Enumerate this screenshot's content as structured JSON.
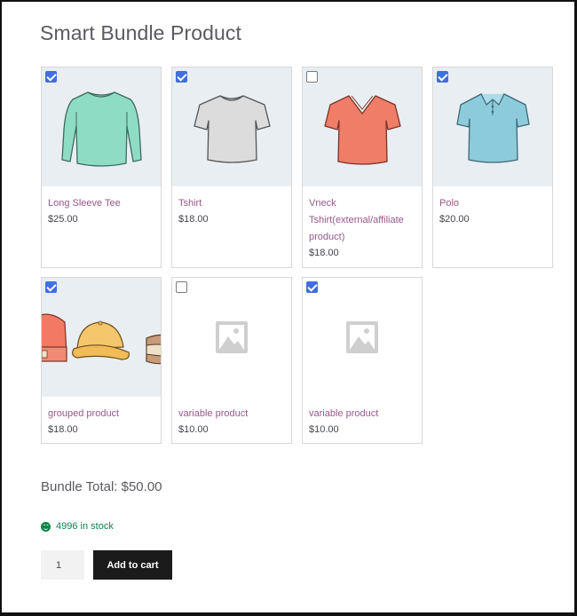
{
  "page": {
    "title": "Smart Bundle Product"
  },
  "products": [
    {
      "name": "Long Sleeve Tee",
      "price": "$25.00",
      "checked": true,
      "image": "long-sleeve-tee-image",
      "color": "#7fd6c0"
    },
    {
      "name": "Tshirt",
      "price": "$18.00",
      "checked": true,
      "image": "tshirt-image",
      "color": "#d9d9d9"
    },
    {
      "name": "Vneck Tshirt(external/affiliate product)",
      "price": "$18.00",
      "checked": false,
      "image": "vneck-tshirt-image",
      "color": "#ef7a66"
    },
    {
      "name": "Polo",
      "price": "$20.00",
      "checked": true,
      "image": "polo-image",
      "color": "#86c7da"
    },
    {
      "name": "grouped product",
      "price": "$18.00",
      "checked": true,
      "image": "hats-image",
      "color": "#f2c36b"
    },
    {
      "name": "variable product",
      "price": "$10.00",
      "checked": false,
      "image": "placeholder-image",
      "color": "#cfcfcf"
    },
    {
      "name": "variable product",
      "price": "$10.00",
      "checked": true,
      "image": "placeholder-image",
      "color": "#cfcfcf"
    }
  ],
  "bundle": {
    "total_label": "Bundle Total: $50.00"
  },
  "stock": {
    "text": "4996 in stock",
    "color": "#0f834d"
  },
  "cart": {
    "quantity": "1",
    "add_label": "Add to cart"
  }
}
